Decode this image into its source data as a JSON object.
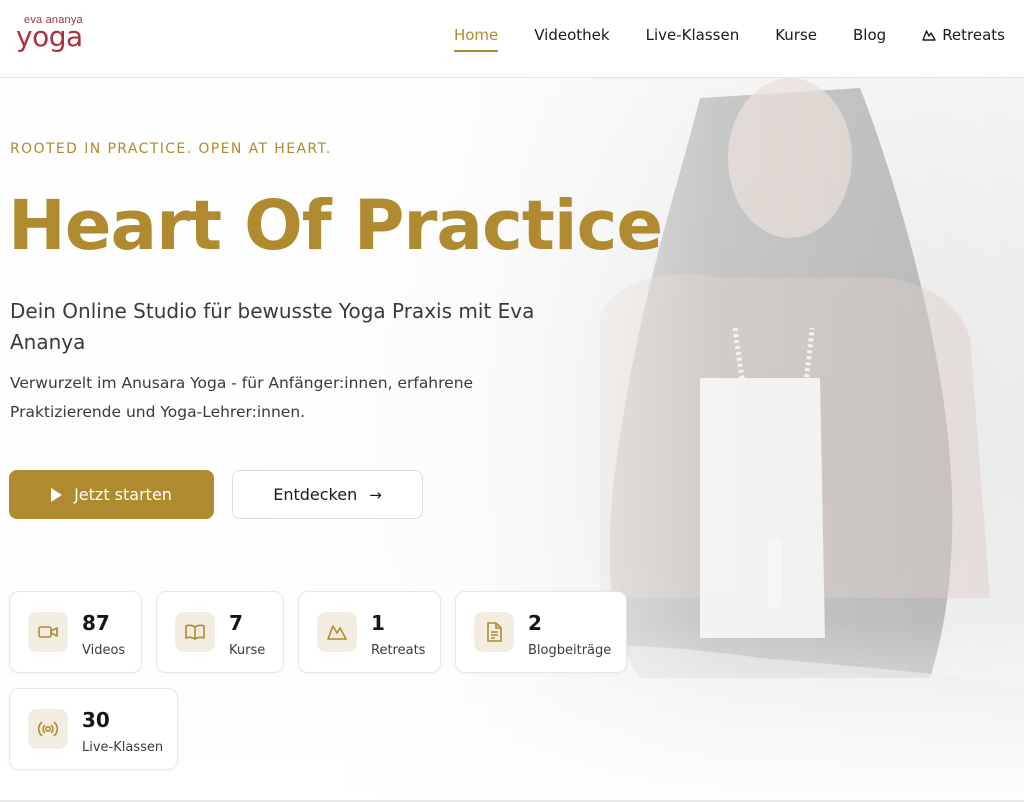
{
  "brand": {
    "logo_small": "eva ananya",
    "logo_big": "yoga"
  },
  "nav": {
    "items": [
      {
        "label": "Home",
        "active": true
      },
      {
        "label": "Videothek",
        "active": false
      },
      {
        "label": "Live-Klassen",
        "active": false
      },
      {
        "label": "Kurse",
        "active": false
      },
      {
        "label": "Blog",
        "active": false
      },
      {
        "label": "Retreats",
        "active": false,
        "icon": "mountain-icon"
      }
    ]
  },
  "hero": {
    "eyebrow": "ROOTED IN PRACTICE. OPEN AT HEART.",
    "title": "Heart Of Practice",
    "subtitle": "Dein Online Studio für bewusste Yoga Praxis mit Eva Ananya",
    "description": "Verwurzelt im Anusara Yoga - für Anfänger:innen, erfahrene Praktizierende und Yoga-Lehrer:innen.",
    "primary_button": {
      "label": "Jetzt starten",
      "icon": "play-icon"
    },
    "secondary_button": {
      "label": "Entdecken",
      "icon": "arrow-right-icon"
    }
  },
  "stats": [
    {
      "value": "87",
      "label": "Videos",
      "icon": "video-camera-icon"
    },
    {
      "value": "7",
      "label": "Kurse",
      "icon": "open-book-icon"
    },
    {
      "value": "1",
      "label": "Retreats",
      "icon": "mountain-icon"
    },
    {
      "value": "2",
      "label": "Blogbeiträge",
      "icon": "document-icon"
    },
    {
      "value": "30",
      "label": "Live-Klassen",
      "icon": "broadcast-icon"
    }
  ],
  "colors": {
    "accent": "#b08a2e",
    "accent_soft": "#f3ece0",
    "logo": "#a8323e",
    "text": "#1b1b1b"
  }
}
